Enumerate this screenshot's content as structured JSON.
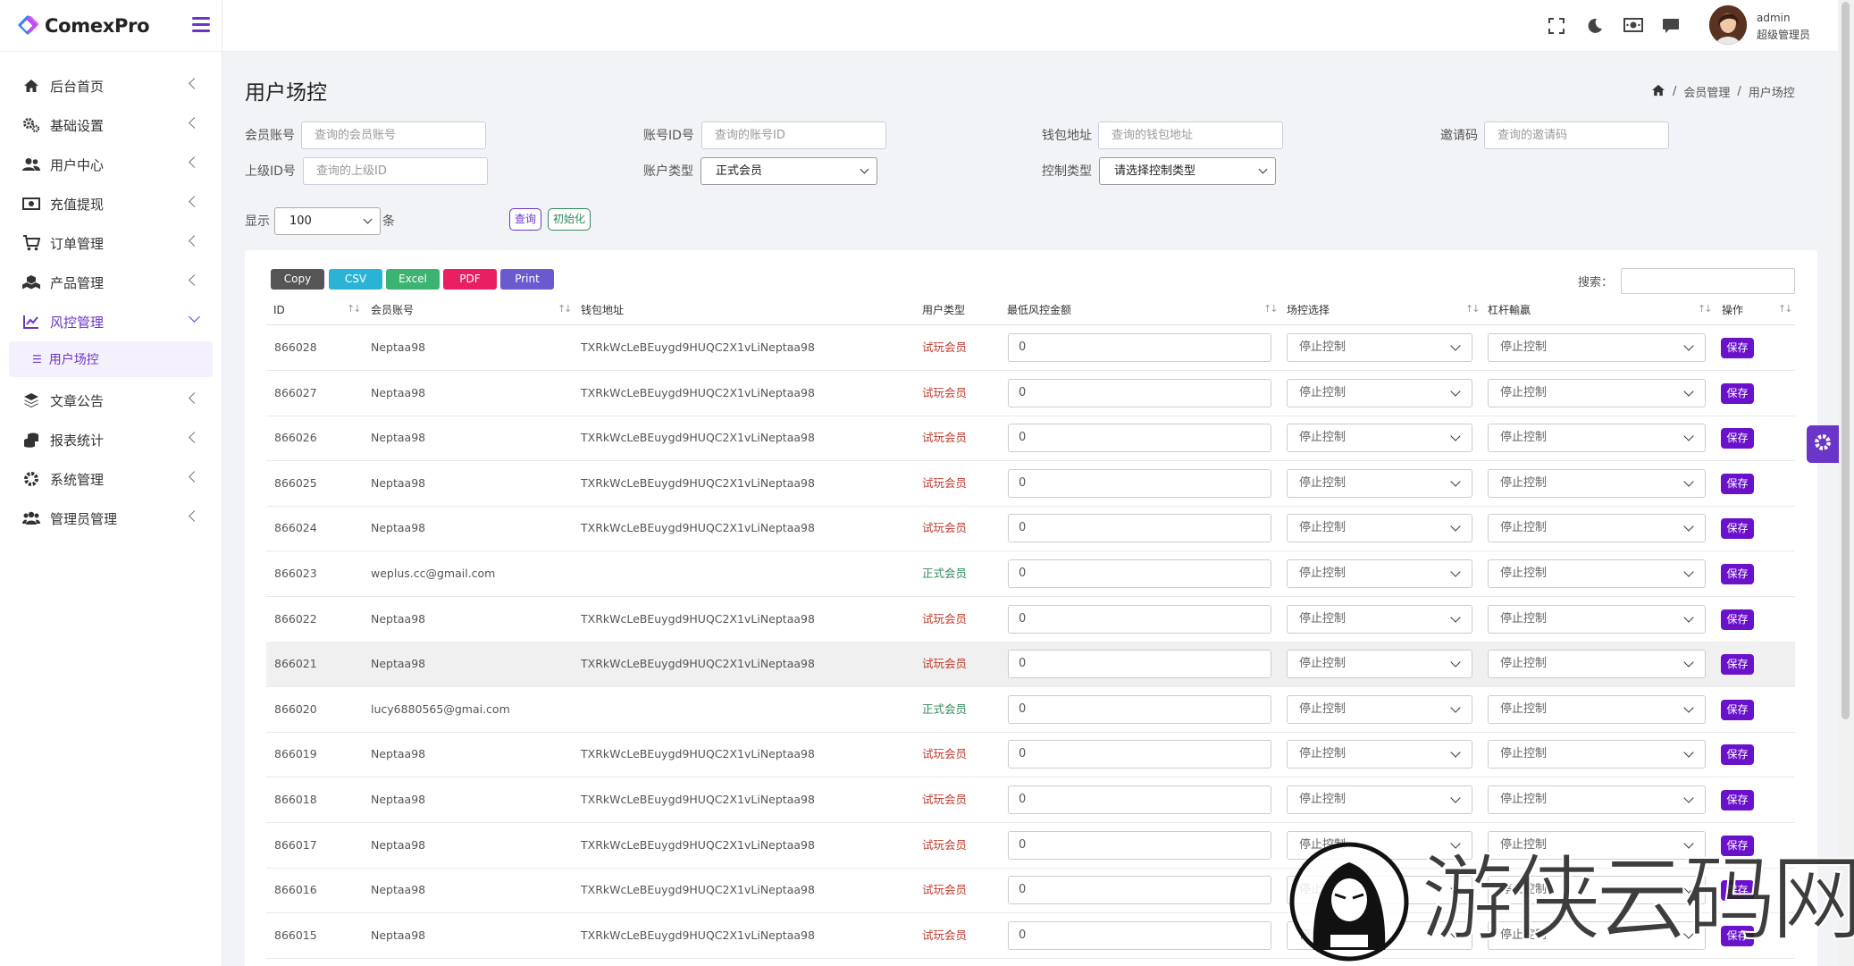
{
  "brand": {
    "name": "ComexPro"
  },
  "sidebar": {
    "items": [
      {
        "label": "后台首页",
        "icon": "home-icon"
      },
      {
        "label": "基础设置",
        "icon": "cogs-icon"
      },
      {
        "label": "用户中心",
        "icon": "users-icon"
      },
      {
        "label": "充值提现",
        "icon": "money-icon"
      },
      {
        "label": "订单管理",
        "icon": "cart-icon"
      },
      {
        "label": "产品管理",
        "icon": "cubes-icon"
      },
      {
        "label": "风控管理",
        "icon": "chart-line-icon"
      },
      {
        "label": "文章公告",
        "icon": "layers-icon"
      },
      {
        "label": "报表统计",
        "icon": "coins-icon"
      },
      {
        "label": "系统管理",
        "icon": "gear-icon"
      },
      {
        "label": "管理员管理",
        "icon": "users-cog-icon"
      }
    ],
    "submenu": {
      "label": "用户场控"
    }
  },
  "topbar": {
    "username": "admin",
    "role": "超级管理员"
  },
  "page": {
    "title": "用户场控"
  },
  "breadcrumb": {
    "sep1": "/",
    "item1": "会员管理",
    "sep2": "/",
    "item2": "用户场控"
  },
  "filters": {
    "member_label": "会员账号",
    "member_placeholder": "查询的会员账号",
    "account_label": "账号ID号",
    "account_placeholder": "查询的账号ID",
    "wallet_label": "钱包地址",
    "wallet_placeholder": "查询的钱包地址",
    "invite_label": "邀请码",
    "invite_placeholder": "查询的邀请码",
    "parent_label": "上级ID号",
    "parent_placeholder": "查询的上级ID",
    "acct_type_label": "账户类型",
    "acct_type_value": "正式会员",
    "ctrl_type_label": "控制类型",
    "ctrl_type_value": "请选择控制类型",
    "show_label": "显示",
    "show_value": "100",
    "show_suffix": "条",
    "query_btn": "查询",
    "init_btn": "初始化"
  },
  "export": {
    "copy": "Copy",
    "csv": "CSV",
    "excel": "Excel",
    "pdf": "PDF",
    "print": "Print"
  },
  "search": {
    "label": "搜索："
  },
  "table": {
    "headers": {
      "id": "ID",
      "member": "会员账号",
      "wallet": "钱包地址",
      "utype": "用户类型",
      "minamt": "最低风控金额",
      "ctrl": "场控选择",
      "lever": "杠杆輸贏",
      "op": "操作"
    },
    "rows": [
      {
        "id": "866028",
        "member": "Neptaa98",
        "wallet": "TXRkWcLeBEuygd9HUQC2X1vLiNeptaa98",
        "utype": "试玩会员",
        "min": "0",
        "ctrl": "停止控制",
        "lever": "停止控制",
        "save": "保存"
      },
      {
        "id": "866027",
        "member": "Neptaa98",
        "wallet": "TXRkWcLeBEuygd9HUQC2X1vLiNeptaa98",
        "utype": "试玩会员",
        "min": "0",
        "ctrl": "停止控制",
        "lever": "停止控制",
        "save": "保存"
      },
      {
        "id": "866026",
        "member": "Neptaa98",
        "wallet": "TXRkWcLeBEuygd9HUQC2X1vLiNeptaa98",
        "utype": "试玩会员",
        "min": "0",
        "ctrl": "停止控制",
        "lever": "停止控制",
        "save": "保存"
      },
      {
        "id": "866025",
        "member": "Neptaa98",
        "wallet": "TXRkWcLeBEuygd9HUQC2X1vLiNeptaa98",
        "utype": "试玩会员",
        "min": "0",
        "ctrl": "停止控制",
        "lever": "停止控制",
        "save": "保存"
      },
      {
        "id": "866024",
        "member": "Neptaa98",
        "wallet": "TXRkWcLeBEuygd9HUQC2X1vLiNeptaa98",
        "utype": "试玩会员",
        "min": "0",
        "ctrl": "停止控制",
        "lever": "停止控制",
        "save": "保存"
      },
      {
        "id": "866023",
        "member": "weplus.cc@gmail.com",
        "wallet": "",
        "utype": "正式会员",
        "min": "0",
        "ctrl": "停止控制",
        "lever": "停止控制",
        "save": "保存"
      },
      {
        "id": "866022",
        "member": "Neptaa98",
        "wallet": "TXRkWcLeBEuygd9HUQC2X1vLiNeptaa98",
        "utype": "试玩会员",
        "min": "0",
        "ctrl": "停止控制",
        "lever": "停止控制",
        "save": "保存"
      },
      {
        "id": "866021",
        "member": "Neptaa98",
        "wallet": "TXRkWcLeBEuygd9HUQC2X1vLiNeptaa98",
        "utype": "试玩会员",
        "min": "0",
        "ctrl": "停止控制",
        "lever": "停止控制",
        "save": "保存"
      },
      {
        "id": "866020",
        "member": "lucy6880565@gmai.com",
        "wallet": "",
        "utype": "正式会员",
        "min": "0",
        "ctrl": "停止控制",
        "lever": "停止控制",
        "save": "保存"
      },
      {
        "id": "866019",
        "member": "Neptaa98",
        "wallet": "TXRkWcLeBEuygd9HUQC2X1vLiNeptaa98",
        "utype": "试玩会员",
        "min": "0",
        "ctrl": "停止控制",
        "lever": "停止控制",
        "save": "保存"
      },
      {
        "id": "866018",
        "member": "Neptaa98",
        "wallet": "TXRkWcLeBEuygd9HUQC2X1vLiNeptaa98",
        "utype": "试玩会员",
        "min": "0",
        "ctrl": "停止控制",
        "lever": "停止控制",
        "save": "保存"
      },
      {
        "id": "866017",
        "member": "Neptaa98",
        "wallet": "TXRkWcLeBEuygd9HUQC2X1vLiNeptaa98",
        "utype": "试玩会员",
        "min": "0",
        "ctrl": "停止控制",
        "lever": "停止控制",
        "save": "保存"
      },
      {
        "id": "866016",
        "member": "Neptaa98",
        "wallet": "TXRkWcLeBEuygd9HUQC2X1vLiNeptaa98",
        "utype": "试玩会员",
        "min": "0",
        "ctrl": "停止控制",
        "lever": "停止控制",
        "save": "保存"
      },
      {
        "id": "866015",
        "member": "Neptaa98",
        "wallet": "TXRkWcLeBEuygd9HUQC2X1vLiNeptaa98",
        "utype": "试玩会员",
        "min": "0",
        "ctrl": "停止控制",
        "lever": "停止控制",
        "save": "保存"
      }
    ]
  },
  "watermark": {
    "text": "游侠云码网"
  },
  "colors": {
    "accent": "#6a35c8",
    "save": "#6a11cb",
    "trial": "#c0392b",
    "real": "#2e8b57"
  }
}
